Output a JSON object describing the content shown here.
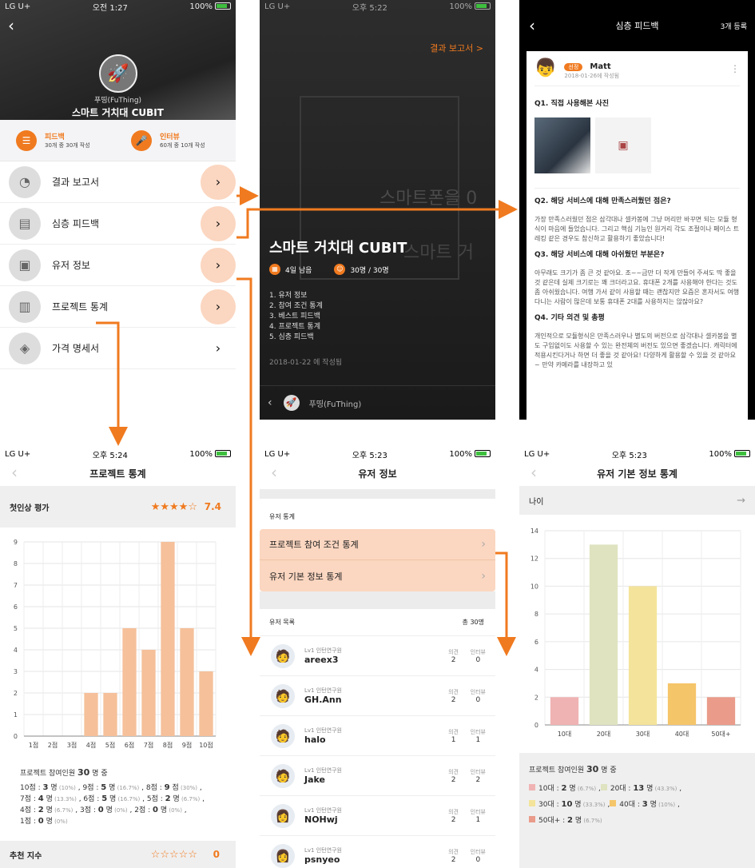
{
  "p1": {
    "status": {
      "carrier": "LG U+",
      "time": "오전 1:27",
      "battery": "100%"
    },
    "hero": {
      "sub": "푸띵(FuThing)",
      "title": "스마트 거치대 CUBIT"
    },
    "stats": [
      {
        "label": "피드백",
        "desc": "30개 중 30개 작성"
      },
      {
        "label": "인터뷰",
        "desc": "60개 중 10개 작성"
      }
    ],
    "menu": [
      {
        "label": "결과 보고서",
        "icon": "report-icon"
      },
      {
        "label": "심층 피드백",
        "icon": "feedback-icon"
      },
      {
        "label": "유저 정보",
        "icon": "users-icon"
      },
      {
        "label": "프로젝트 통계",
        "icon": "stats-icon"
      },
      {
        "label": "가격 명세서",
        "icon": "price-tag-icon"
      }
    ]
  },
  "p2": {
    "status": {
      "carrier": "LG U+",
      "time": "오후 5:22",
      "battery": "100%"
    },
    "link": "결과 보고서 >",
    "title": "스마트 거치대 CUBIT",
    "days": "4일 남음",
    "people": "30명 / 30명",
    "items": [
      "1. 유저 정보",
      "2. 참여 조건 통계",
      "3. 베스트 피드백",
      "4. 프로젝트 통계",
      "5. 심층 피드백"
    ],
    "date": "2018-01-22 에 작성됨",
    "footer": "푸띵(FuThing)",
    "bg_text": "스마트폰을 0",
    "bg_text2": "스마트 거"
  },
  "p3": {
    "nav": {
      "title": "심층 피드백",
      "right": "3개 등록"
    },
    "badge": "선정",
    "name": "Matt",
    "date": "2018-01-26에 작성됨",
    "q1": "Q1. 직접 사용해본 사진",
    "q2": "Q2. 해당 서비스에 대해 만족스러웠던 점은?",
    "a2": "가장 만족스러웠던 점은 삼각대나 셀카봉에 그냥 머리만 바꾸면 되는 모듈 형식이 마음에 들었습니다. 그리고 핵심 기능인 원거리 각도 조절이나 페이스 트레킹 같은 경우도 참신하고 활용하기 좋았습니다!",
    "q3": "Q3. 해당 서비스에 대해 아쉬웠던 부분은?",
    "a3": "아무래도 크기가 좀 큰 것 같아요. 조~~금만 더 작게 만들어 주셔도 딱 좋을 것 같은데 실제 크기로는 꽤 크더라고요. 휴대폰 2개를 사용해야 한다는 것도 좀 아쉬웠습니다. 여행 가서 같이 사용할 때는 괜찮지만 요즘은 혼자서도 여행 다니는 사람이 많은데 보통 휴대폰 2대를 사용하지는 않잖아요?",
    "q4": "Q4. 기타 의견 및 총평",
    "a4": "개인적으로 모듈형식은 만족스러우나 별도의 버전으로 삼각대나 셀카봉을 별도 구입없이도 사용할 수 있는 완전체의 버전도 있으면 좋겠습니다. 캐릭터에 적용시킨다거나 하면 더 좋을 것 같아요! 다양하게 활용할 수 있을 것 같아요~ 만약 카메라를 내장하고 있"
  },
  "p4": {
    "status": {
      "carrier": "LG U+",
      "time": "오후 5:24",
      "battery": "100%"
    },
    "nav": "프로젝트 통계",
    "rating": {
      "label": "첫인상 평가",
      "stars": "★★★★☆",
      "value": "7.4",
      "fraction": 0.74
    },
    "note_head": "프로젝트 참여인원",
    "note_count": "30",
    "note_unit": "명 중",
    "notes": [
      {
        "t": "10점 : ",
        "n": "3",
        "u": " 명",
        "p": " (10%)",
        "s": " ,"
      },
      {
        "t": "  9점 : ",
        "n": "5",
        "u": " 명",
        "p": " (16.7%)",
        "s": " ,"
      },
      {
        "t": "  8점 : ",
        "n": "9",
        "u": " 점",
        "p": " (30%)",
        "s": " ,"
      },
      {
        "t": "7점 : ",
        "n": "4",
        "u": " 명",
        "p": " (13.3%)",
        "s": " ,"
      },
      {
        "t": "  6점 : ",
        "n": "5",
        "u": " 명",
        "p": " (16.7%)",
        "s": " ,"
      },
      {
        "t": "  5점 : ",
        "n": "2",
        "u": " 명",
        "p": " (6.7%)",
        "s": " ,"
      },
      {
        "t": "4점 : ",
        "n": "2",
        "u": " 명",
        "p": " (6.7%)",
        "s": " ,"
      },
      {
        "t": "  3점 : ",
        "n": "0",
        "u": " 명",
        "p": " (0%)",
        "s": " ,"
      },
      {
        "t": "  2점 : ",
        "n": "0",
        "u": " 명",
        "p": " (0%)",
        "s": " ,"
      },
      {
        "t": "1점 : ",
        "n": "0",
        "u": " 명",
        "p": " (0%)",
        "s": ""
      }
    ],
    "reco": {
      "label": "추천 지수",
      "stars": "☆☆☆☆☆",
      "value": "0"
    }
  },
  "p5": {
    "status": {
      "carrier": "LG U+",
      "time": "오후 5:23",
      "battery": "100%"
    },
    "nav": "유저 정보",
    "section": "유저 통계",
    "links": [
      "프로젝트 참여 조건 통계",
      "유저 기본 정보 통계"
    ],
    "list_title": "유저 목록",
    "list_total": "총 30명",
    "col1": "의견",
    "col2": "인터뷰",
    "users": [
      {
        "lv": "Lv1 인턴연구원",
        "name": "areex3",
        "a": "2",
        "b": "0"
      },
      {
        "lv": "Lv1 인턴연구원",
        "name": "GH.Ann",
        "a": "2",
        "b": "0"
      },
      {
        "lv": "Lv1 인턴연구원",
        "name": "halo",
        "a": "1",
        "b": "1"
      },
      {
        "lv": "Lv1 인턴연구원",
        "name": "Jake",
        "a": "2",
        "b": "2"
      },
      {
        "lv": "Lv1 인턴연구원",
        "name": "NOHwj",
        "a": "2",
        "b": "1"
      },
      {
        "lv": "Lv1 인턴연구원",
        "name": "psnyeo",
        "a": "2",
        "b": "0"
      }
    ]
  },
  "p6": {
    "status": {
      "carrier": "LG U+",
      "time": "오후 5:23",
      "battery": "100%"
    },
    "nav": "유저 기본 정보 통계",
    "section": "나이",
    "note_head": "프로젝트 참여인원",
    "note_count": "30",
    "note_unit": "명 중",
    "notes": [
      {
        "t": "10대 : ",
        "n": "2",
        "u": " 명",
        "p": " (6.7%)",
        "s": " ,",
        "c": "#f0b3b3"
      },
      {
        "t": "20대 : ",
        "n": "13",
        "u": " 명",
        "p": " (43.3%)",
        "s": " ,",
        "c": "#dfe3c0"
      },
      {
        "t": "30대 : ",
        "n": "10",
        "u": " 명",
        "p": " (33.3%)",
        "s": " ,",
        "c": "#f4e49b"
      },
      {
        "t": "40대 : ",
        "n": "3",
        "u": " 명",
        "p": " (10%)",
        "s": " ,",
        "c": "#f5c56a"
      },
      {
        "t": "50대+ : ",
        "n": "2",
        "u": " 명",
        "p": " (6.7%)",
        "s": "",
        "c": "#ea9b8a"
      }
    ]
  },
  "chart_data": [
    {
      "type": "bar",
      "categories": [
        "1점",
        "2점",
        "3점",
        "4점",
        "5점",
        "6점",
        "7점",
        "8점",
        "9점",
        "10점"
      ],
      "values": [
        0,
        0,
        0,
        2,
        2,
        5,
        4,
        9,
        5,
        3
      ],
      "ylim": [
        0,
        9
      ],
      "yticks": [
        0,
        1,
        2,
        3,
        4,
        5,
        6,
        7,
        8,
        9
      ],
      "color": "#f5c09a",
      "grid": true
    },
    {
      "type": "bar",
      "categories": [
        "10대",
        "20대",
        "30대",
        "40대",
        "50대+"
      ],
      "values": [
        2,
        13,
        10,
        3,
        2
      ],
      "ylim": [
        0,
        14
      ],
      "yticks": [
        0,
        2,
        4,
        6,
        8,
        10,
        12,
        14
      ],
      "colors": [
        "#f0b3b3",
        "#dfe3c0",
        "#f4e49b",
        "#f5c56a",
        "#ea9b8a"
      ],
      "grid": true
    }
  ]
}
